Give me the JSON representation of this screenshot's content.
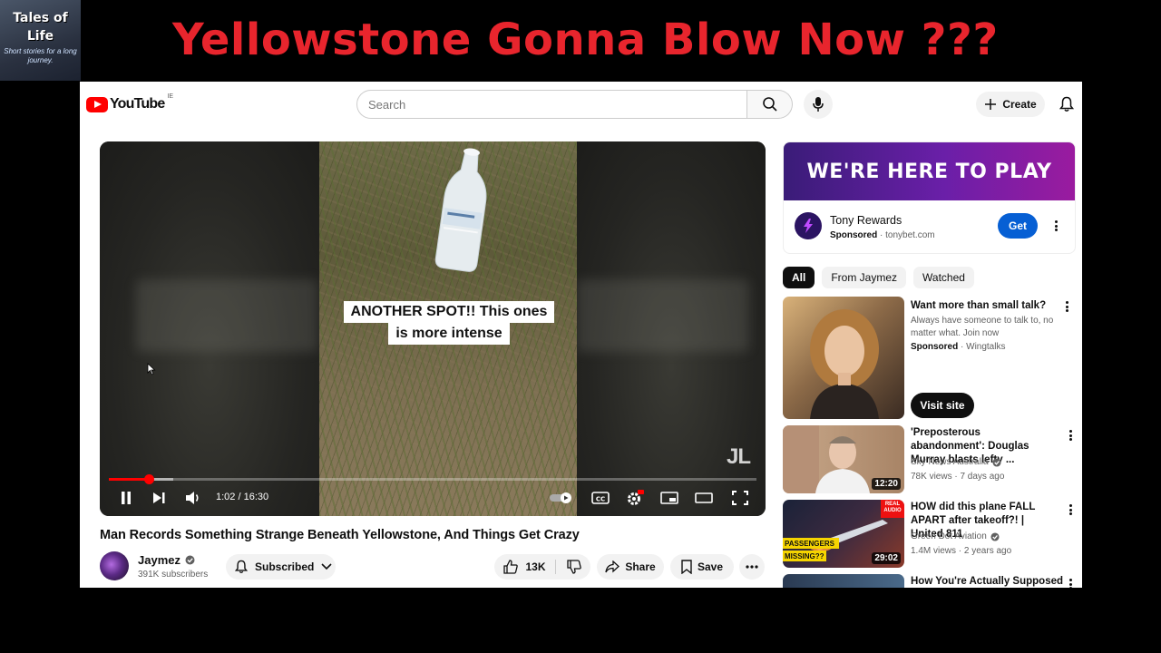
{
  "overlay": {
    "logo_line1": "Tales of",
    "logo_line2": "Life",
    "logo_tagline": "Short stories for a long journey.",
    "headline": "Yellowstone Gonna Blow Now ???"
  },
  "header": {
    "brand": "YouTube",
    "country": "IE",
    "search_placeholder": "Search",
    "create_label": "Create"
  },
  "player": {
    "caption_line1": "ANOTHER SPOT!! This ones",
    "caption_line2": "is more intense",
    "watermark": "JL",
    "time": "1:02 / 16:30",
    "progress": 0.062,
    "buffered": 0.1
  },
  "video": {
    "title": "Man Records Something Strange Beneath Yellowstone, And Things Get Crazy",
    "channel": "Jaymez",
    "subscribers": "391K subscribers",
    "subscribed_label": "Subscribed",
    "likes": "13K",
    "share_label": "Share",
    "save_label": "Save"
  },
  "ad": {
    "banner": "WE'RE HERE TO PLAY",
    "name": "Tony Rewards",
    "sponsored": "Sponsored",
    "domain": "tonybet.com",
    "cta": "Get"
  },
  "chips": [
    "All",
    "From Jaymez",
    "Watched"
  ],
  "recommendations": [
    {
      "title": "Want more than small talk?",
      "desc": "Always have someone to talk to, no matter what. Join now",
      "sponsored": "Sponsored",
      "advertiser": "Wingtalks",
      "cta": "Visit site"
    },
    {
      "title": "'Preposterous abandonment': Douglas Murray blasts lefty ...",
      "channel": "Sky News Australia",
      "meta": "78K views · 7 days ago",
      "duration": "12:20"
    },
    {
      "title": "HOW did this plane FALL APART after takeoff?! | United 811",
      "channel": "Green Dot Aviation",
      "meta": "1.4M views · 2 years ago",
      "duration": "29:02",
      "thumb_text1": "PASSENGERS",
      "thumb_text2": "MISSING??",
      "thumb_badge": "REAL AUDIO"
    },
    {
      "title": "How You're Actually Supposed"
    }
  ],
  "colors": {
    "headline": "#e8252d",
    "youtube_red": "#ff0000",
    "get_button": "#065fd4"
  }
}
